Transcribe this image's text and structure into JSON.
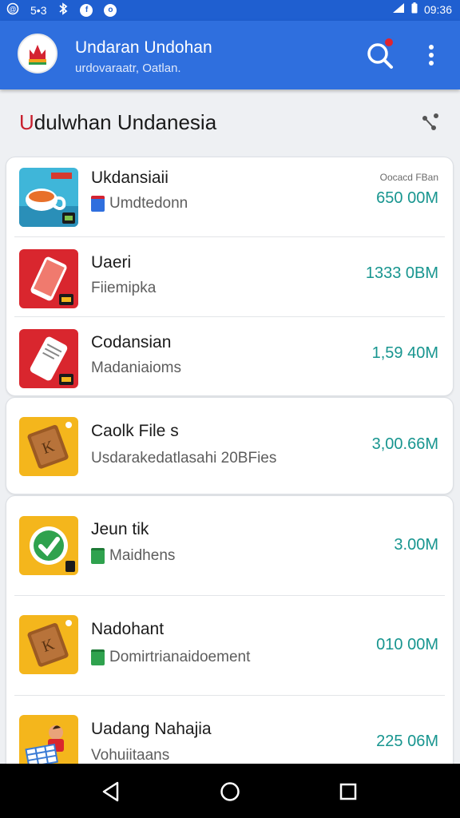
{
  "status_bar": {
    "time": "09:36",
    "carrier": "5•3",
    "icons": [
      "notification-icon",
      "bluetooth-icon",
      "app-icon",
      "chat-icon",
      "signal-icon",
      "battery-icon"
    ]
  },
  "app_bar": {
    "title": "Undaran Undohan",
    "subtitle": "urdovaraatr, Oatlan.",
    "color": "#2f6fde",
    "search_icon": "search-icon",
    "more_icon": "more-vert-icon"
  },
  "section": {
    "title_first": "U",
    "title_rest": "dulwhan Undanesia",
    "share_icon": "share-icon"
  },
  "cards": [
    {
      "items": [
        {
          "title": "Ukdansiaii",
          "subtitle": "Umdtedonn",
          "size": "650 00M",
          "meta": "Oocacd FBan",
          "icon": "tea-cup-icon",
          "sub_icon": "folder-icon"
        },
        {
          "title": "Uaeri",
          "subtitle": "Fiiemipka",
          "size": "1333 0BM",
          "meta": "",
          "icon": "phone-icon",
          "sub_icon": ""
        },
        {
          "title": "Codansian",
          "subtitle": "Madaniaioms",
          "size": "1,59 40M",
          "meta": "",
          "icon": "phone-icon",
          "sub_icon": ""
        }
      ]
    },
    {
      "items": [
        {
          "title": "Caolk File s",
          "subtitle": "Usdarakedatlasahi 20BFies",
          "size": "3,00.66M",
          "meta": "",
          "icon": "book-icon",
          "sub_icon": ""
        }
      ]
    },
    {
      "items": [
        {
          "title": "Jeun tik",
          "subtitle": "Maidhens",
          "size": "3.00M",
          "meta": "",
          "icon": "check-icon",
          "sub_icon": "battery-icon"
        },
        {
          "title": "Nadohant",
          "subtitle": "Domirtrianaidoement",
          "size": "010 00M",
          "meta": "",
          "icon": "book-icon",
          "sub_icon": "battery-icon"
        },
        {
          "title": "Uadang Nahajia",
          "subtitle": "Vohuiitaans",
          "size": "225 06M",
          "meta": "",
          "icon": "person-box-icon",
          "sub_icon": ""
        }
      ]
    }
  ],
  "nav_bar": {
    "back_icon": "back-icon",
    "home_icon": "home-icon",
    "recents_icon": "recents-icon"
  }
}
